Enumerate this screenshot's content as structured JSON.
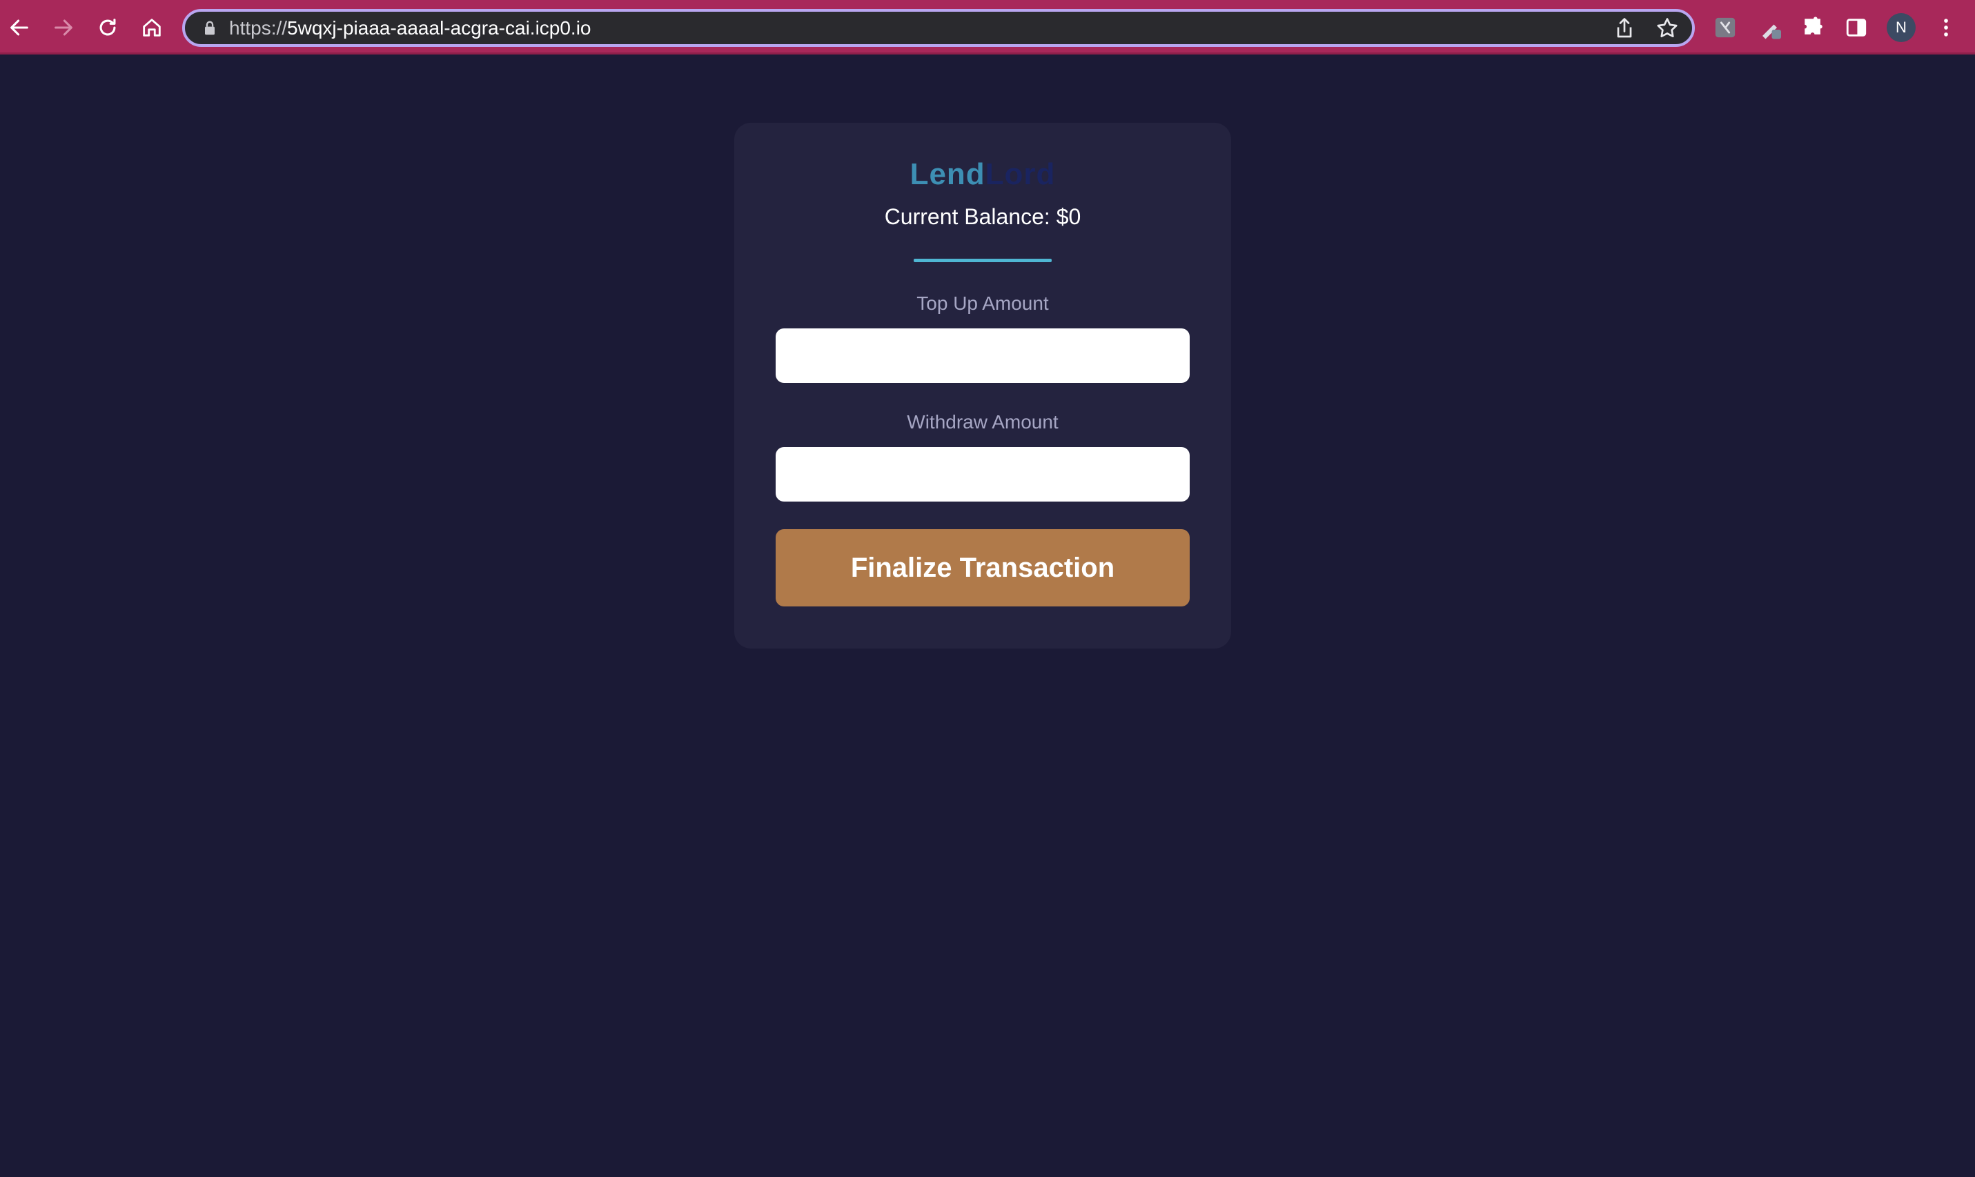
{
  "browser": {
    "url_scheme": "https://",
    "url_host": "5wqxj-piaaa-aaaal-acgra-cai.icp0.io",
    "profile_initial": "N",
    "toolbar_color": "#a8285a",
    "icons": [
      "back-arrow-icon",
      "forward-arrow-icon",
      "reload-icon",
      "home-icon",
      "lock-icon",
      "share-icon",
      "bookmark-star-icon",
      "extension-icon",
      "pen-extension-icon",
      "puzzle-icon",
      "side-panel-icon",
      "more-menu-icon"
    ]
  },
  "app": {
    "logo_part1": "Lend",
    "logo_part2": "Lord",
    "balance_text": "Current Balance: $0",
    "top_up": {
      "label": "Top Up Amount",
      "value": "",
      "placeholder": ""
    },
    "withdraw": {
      "label": "Withdraw Amount",
      "value": "",
      "placeholder": ""
    },
    "finalize_label": "Finalize Transaction",
    "colors": {
      "background": "#1b1a36",
      "card": "#24233f",
      "accent": "#4fb6d3",
      "button": "#b07a4a"
    }
  }
}
